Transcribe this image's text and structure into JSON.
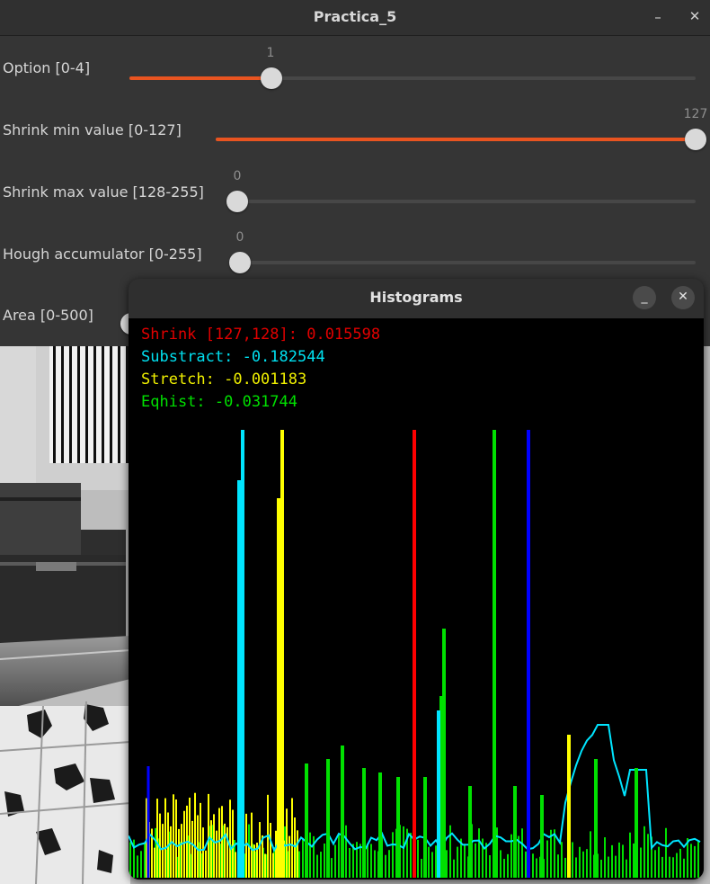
{
  "main_window": {
    "title": "Practica_5",
    "trackbars": [
      {
        "label": "Option [0-4]",
        "value": "1",
        "fraction": 0.25,
        "color": "#e95420"
      },
      {
        "label": "Shrink min value [0-127]",
        "value": "127",
        "fraction": 1.0,
        "color": "#e95420"
      },
      {
        "label": "Shrink max value [128-255]",
        "value": "0",
        "fraction": 0.0,
        "color": "#e95420"
      },
      {
        "label": "Hough accumulator [0-255]",
        "value": "0",
        "fraction": 0.0,
        "color": "#e95420"
      },
      {
        "label": "Area [0-500]",
        "value": "",
        "fraction": 0.0,
        "color": "#e95420"
      }
    ]
  },
  "histogram_window": {
    "title": "Histograms",
    "legend": [
      {
        "text": "Shrink [127,128]: 0.015598",
        "color": "#e10000"
      },
      {
        "text": "Substract: -0.182544",
        "color": "#00e0f0"
      },
      {
        "text": "Stretch: -0.001183",
        "color": "#f0f000"
      },
      {
        "text": "Eqhist: -0.031744",
        "color": "#00e000"
      }
    ],
    "series_colors": {
      "shrink": "#ff0000",
      "substract": "#00e5ff",
      "stretch": "#ffff00",
      "eqhist": "#00e000",
      "blue": "#0000ff"
    }
  },
  "icons": {
    "minimize": "minimize-icon",
    "close": "close-icon"
  },
  "glyphs": {
    "minimize": "–",
    "close": "✕",
    "dialog_minimize": "_",
    "dialog_close": "✕"
  }
}
